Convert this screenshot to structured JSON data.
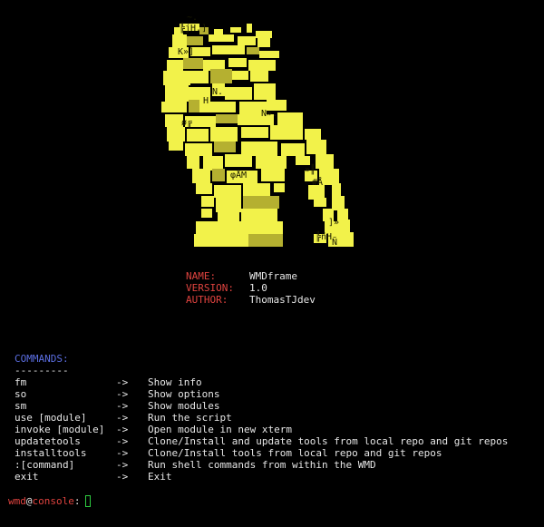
{
  "colors": {
    "background": "#000000",
    "text": "#e6e6e6",
    "key_red": "#e0433f",
    "heading_blue": "#5b6ee1",
    "logo_yellow": "#f2f24a",
    "logo_olive": "#b5b030",
    "cursor_green": "#2ecc40"
  },
  "logo": {
    "icon": "ascii-art-logo-icon",
    "art_fragments": [
      "~.",
      "╠jH.]",
      "K»]",
      "N.",
      "H",
      "N».",
      "ø╔",
      "φÅM",
      "»║",
      "#Å",
      "]»",
      "╠ñH",
      "Ñ"
    ]
  },
  "info": {
    "name_key": "NAME:",
    "name_value": "WMDframe",
    "version_key": "VERSION:",
    "version_value": "1.0",
    "author_key": "AUTHOR:",
    "author_value": "ThomasTJdev"
  },
  "commands": {
    "heading": "COMMANDS:",
    "rule": "---------",
    "arrow": "->",
    "items": [
      {
        "name": "fm",
        "desc": "Show info"
      },
      {
        "name": "so",
        "desc": "Show options"
      },
      {
        "name": "sm",
        "desc": "Show modules"
      },
      {
        "name": "use [module]",
        "desc": "Run the script"
      },
      {
        "name": "invoke [module]",
        "desc": "Open module in new xterm"
      },
      {
        "name": "updatetools",
        "desc": "Clone/Install and update tools from local repo and git repos"
      },
      {
        "name": "installtools",
        "desc": "Clone/Install tools from local repo and git repos"
      },
      {
        "name": ":[command]",
        "desc": "Run shell commands from within the WMD"
      },
      {
        "name": "exit",
        "desc": "Exit"
      }
    ]
  },
  "prompt": {
    "user": "wmd",
    "at": "@",
    "host": "console",
    "suffix": ":"
  }
}
